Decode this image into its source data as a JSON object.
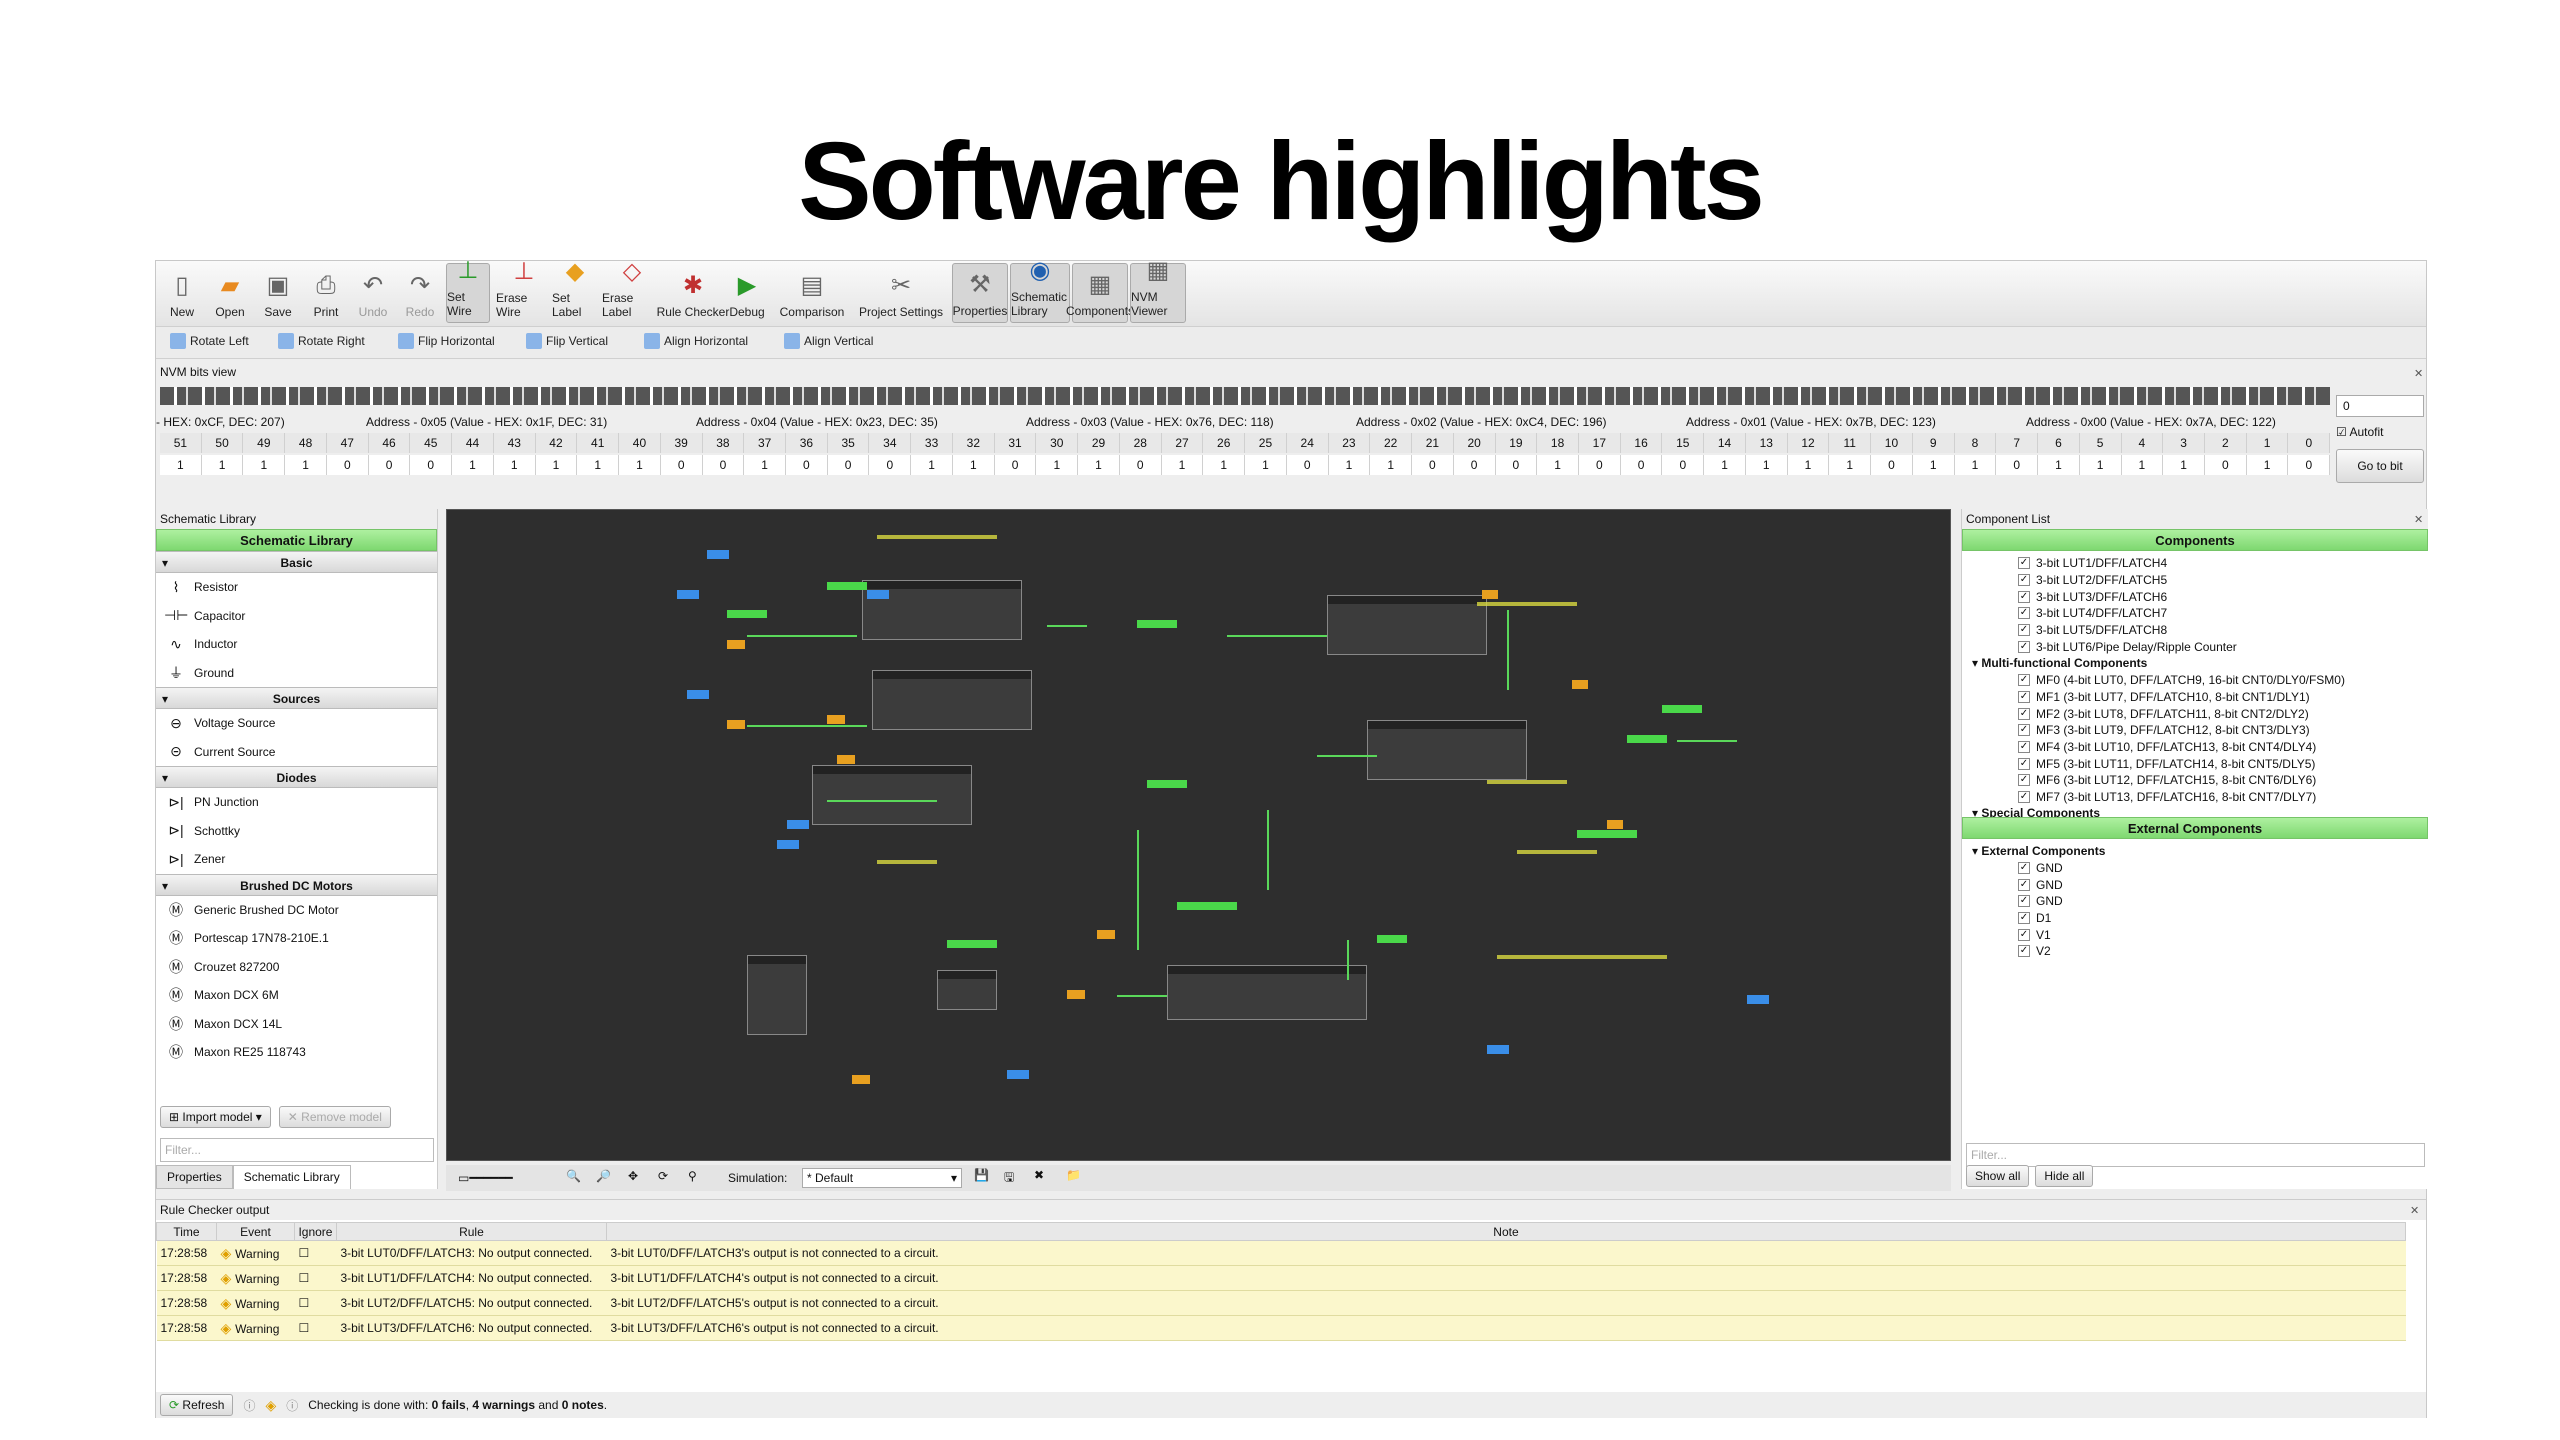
{
  "slide": {
    "title": "Software highlights"
  },
  "toolbar": {
    "buttons": [
      {
        "label": "New",
        "icon": "new-file-icon"
      },
      {
        "label": "Open",
        "icon": "folder-icon"
      },
      {
        "label": "Save",
        "icon": "save-icon"
      },
      {
        "label": "Print",
        "icon": "printer-icon"
      },
      {
        "label": "Undo",
        "icon": "undo-icon"
      },
      {
        "label": "Redo",
        "icon": "redo-icon"
      },
      {
        "label": "Set Wire",
        "icon": "wire-icon"
      },
      {
        "label": "Erase Wire",
        "icon": "erase-wire-icon"
      },
      {
        "label": "Set Label",
        "icon": "label-icon"
      },
      {
        "label": "Erase Label",
        "icon": "erase-label-icon"
      },
      {
        "label": "Rule Checker",
        "icon": "bug-icon"
      },
      {
        "label": "Debug",
        "icon": "debug-icon"
      },
      {
        "label": "Comparison",
        "icon": "comparison-icon"
      },
      {
        "label": "Project Settings",
        "icon": "tools-icon"
      },
      {
        "label": "Properties",
        "icon": "hammer-icon"
      },
      {
        "label": "Schematic Library",
        "icon": "library-icon"
      },
      {
        "label": "Components",
        "icon": "chip-icon"
      },
      {
        "label": "NVM Viewer",
        "icon": "grid-icon"
      }
    ],
    "secondary": [
      {
        "label": "Rotate Left"
      },
      {
        "label": "Rotate Right"
      },
      {
        "label": "Flip Horizontal"
      },
      {
        "label": "Flip Vertical"
      },
      {
        "label": "Align Horizontal"
      },
      {
        "label": "Align Vertical"
      }
    ]
  },
  "nvm": {
    "title": "NVM bits view",
    "addresses": [
      "- HEX: 0xCF, DEC: 207)",
      "Address - 0x05 (Value - HEX: 0x1F, DEC: 31)",
      "Address - 0x04 (Value - HEX: 0x23, DEC: 35)",
      "Address - 0x03 (Value - HEX: 0x76, DEC: 118)",
      "Address - 0x02 (Value - HEX: 0xC4, DEC: 196)",
      "Address - 0x01 (Value - HEX: 0x7B, DEC: 123)",
      "Address - 0x00 (Value - HEX: 0x7A, DEC: 122)"
    ],
    "indices": [
      "51",
      "50",
      "49",
      "48",
      "47",
      "46",
      "45",
      "44",
      "43",
      "42",
      "41",
      "40",
      "39",
      "38",
      "37",
      "36",
      "35",
      "34",
      "33",
      "32",
      "31",
      "30",
      "29",
      "28",
      "27",
      "26",
      "25",
      "24",
      "23",
      "22",
      "21",
      "20",
      "19",
      "18",
      "17",
      "16",
      "15",
      "14",
      "13",
      "12",
      "11",
      "10",
      "9",
      "8",
      "7",
      "6",
      "5",
      "4",
      "3",
      "2",
      "1",
      "0"
    ],
    "values": [
      "1",
      "1",
      "1",
      "1",
      "0",
      "0",
      "0",
      "1",
      "1",
      "1",
      "1",
      "1",
      "0",
      "0",
      "1",
      "0",
      "0",
      "0",
      "1",
      "1",
      "0",
      "1",
      "1",
      "0",
      "1",
      "1",
      "1",
      "0",
      "1",
      "1",
      "0",
      "0",
      "0",
      "1",
      "0",
      "0",
      "0",
      "1",
      "1",
      "1",
      "1",
      "0",
      "1",
      "1",
      "0",
      "1",
      "1",
      "1",
      "1",
      "0",
      "1",
      "0"
    ],
    "spin_value": "0",
    "autofit_label": "Autofit",
    "goto_label": "Go to bit"
  },
  "left_panel": {
    "title": "Schematic Library",
    "header": "Schematic Library",
    "groups": [
      {
        "name": "Basic",
        "items": [
          {
            "label": "Resistor",
            "sym": "⌇"
          },
          {
            "label": "Capacitor",
            "sym": "⊣⊢"
          },
          {
            "label": "Inductor",
            "sym": "∿"
          },
          {
            "label": "Ground",
            "sym": "⏚"
          }
        ]
      },
      {
        "name": "Sources",
        "items": [
          {
            "label": "Voltage Source",
            "sym": "⊖"
          },
          {
            "label": "Current Source",
            "sym": "⊝"
          }
        ]
      },
      {
        "name": "Diodes",
        "items": [
          {
            "label": "PN Junction",
            "sym": "⊳|"
          },
          {
            "label": "Schottky",
            "sym": "⊳|"
          },
          {
            "label": "Zener",
            "sym": "⊳|"
          }
        ]
      },
      {
        "name": "Brushed DC Motors",
        "items": [
          {
            "label": "Generic Brushed DC Motor",
            "sym": "Ⓜ"
          },
          {
            "label": "Portescap 17N78-210E.1",
            "sym": "Ⓜ"
          },
          {
            "label": "Crouzet 827200",
            "sym": "Ⓜ"
          },
          {
            "label": "Maxon DCX 6M",
            "sym": "Ⓜ"
          },
          {
            "label": "Maxon DCX 14L",
            "sym": "Ⓜ"
          },
          {
            "label": "Maxon RE25 118743",
            "sym": "Ⓜ"
          }
        ]
      }
    ],
    "import_label": "Import model",
    "remove_label": "Remove model",
    "filter_placeholder": "Filter...",
    "tabs": [
      "Properties",
      "Schematic Library"
    ]
  },
  "canvas_bar": {
    "simulation_label": "Simulation:",
    "simulation_value": "* Default"
  },
  "right_panel": {
    "title": "Component List",
    "components_header": "Components",
    "components": [
      {
        "type": "item",
        "label": "3-bit LUT1/DFF/LATCH4"
      },
      {
        "type": "item",
        "label": "3-bit LUT2/DFF/LATCH5"
      },
      {
        "type": "item",
        "label": "3-bit LUT3/DFF/LATCH6"
      },
      {
        "type": "item",
        "label": "3-bit LUT4/DFF/LATCH7"
      },
      {
        "type": "item",
        "label": "3-bit LUT5/DFF/LATCH8"
      },
      {
        "type": "item",
        "label": "3-bit LUT6/Pipe Delay/Ripple Counter"
      },
      {
        "type": "group",
        "label": "Multi-functional Components"
      },
      {
        "type": "item",
        "label": "MF0 (4-bit LUT0, DFF/LATCH9, 16-bit CNT0/DLY0/FSM0)"
      },
      {
        "type": "item",
        "label": "MF1 (3-bit LUT7, DFF/LATCH10, 8-bit CNT1/DLY1)"
      },
      {
        "type": "item",
        "label": "MF2 (3-bit LUT8, DFF/LATCH11, 8-bit CNT2/DLY2)"
      },
      {
        "type": "item",
        "label": "MF3 (3-bit LUT9, DFF/LATCH12, 8-bit CNT3/DLY3)"
      },
      {
        "type": "item",
        "label": "MF4 (3-bit LUT10, DFF/LATCH13, 8-bit CNT4/DLY4)"
      },
      {
        "type": "item",
        "label": "MF5 (3-bit LUT11, DFF/LATCH14, 8-bit CNT5/DLY5)"
      },
      {
        "type": "item",
        "label": "MF6 (3-bit LUT12, DFF/LATCH15, 8-bit CNT6/DLY6)"
      },
      {
        "type": "item",
        "label": "MF7 (3-bit LUT13, DFF/LATCH16, 8-bit CNT7/DLY7)"
      },
      {
        "type": "group",
        "label": "Special Components"
      }
    ],
    "external_header": "External Components",
    "external": [
      {
        "type": "group",
        "label": "External Components"
      },
      {
        "type": "item",
        "label": "GND"
      },
      {
        "type": "item",
        "label": "GND"
      },
      {
        "type": "item",
        "label": "GND"
      },
      {
        "type": "item",
        "label": "D1"
      },
      {
        "type": "item",
        "label": "V1"
      },
      {
        "type": "item",
        "label": "V2"
      }
    ],
    "filter_placeholder": "Filter...",
    "show_all": "Show all",
    "hide_all": "Hide all"
  },
  "rule_checker": {
    "title": "Rule Checker output",
    "columns": [
      "Time",
      "Event",
      "Ignore",
      "Rule",
      "Note"
    ],
    "rows": [
      {
        "time": "17:28:58",
        "event": "Warning",
        "rule": "3-bit LUT0/DFF/LATCH3: No output connected.",
        "note": "3-bit LUT0/DFF/LATCH3's output is not connected to a circuit."
      },
      {
        "time": "17:28:58",
        "event": "Warning",
        "rule": "3-bit LUT1/DFF/LATCH4: No output connected.",
        "note": "3-bit LUT1/DFF/LATCH4's output is not connected to a circuit."
      },
      {
        "time": "17:28:58",
        "event": "Warning",
        "rule": "3-bit LUT2/DFF/LATCH5: No output connected.",
        "note": "3-bit LUT2/DFF/LATCH5's output is not connected to a circuit."
      },
      {
        "time": "17:28:58",
        "event": "Warning",
        "rule": "3-bit LUT3/DFF/LATCH6: No output connected.",
        "note": "3-bit LUT3/DFF/LATCH6's output is not connected to a circuit."
      }
    ],
    "refresh_label": "Refresh",
    "status_prefix": "Checking is done with: ",
    "status_fails": "0 fails",
    "status_sep1": ", ",
    "status_warnings": "4 warnings",
    "status_sep2": " and ",
    "status_notes": "0 notes",
    "status_end": "."
  }
}
